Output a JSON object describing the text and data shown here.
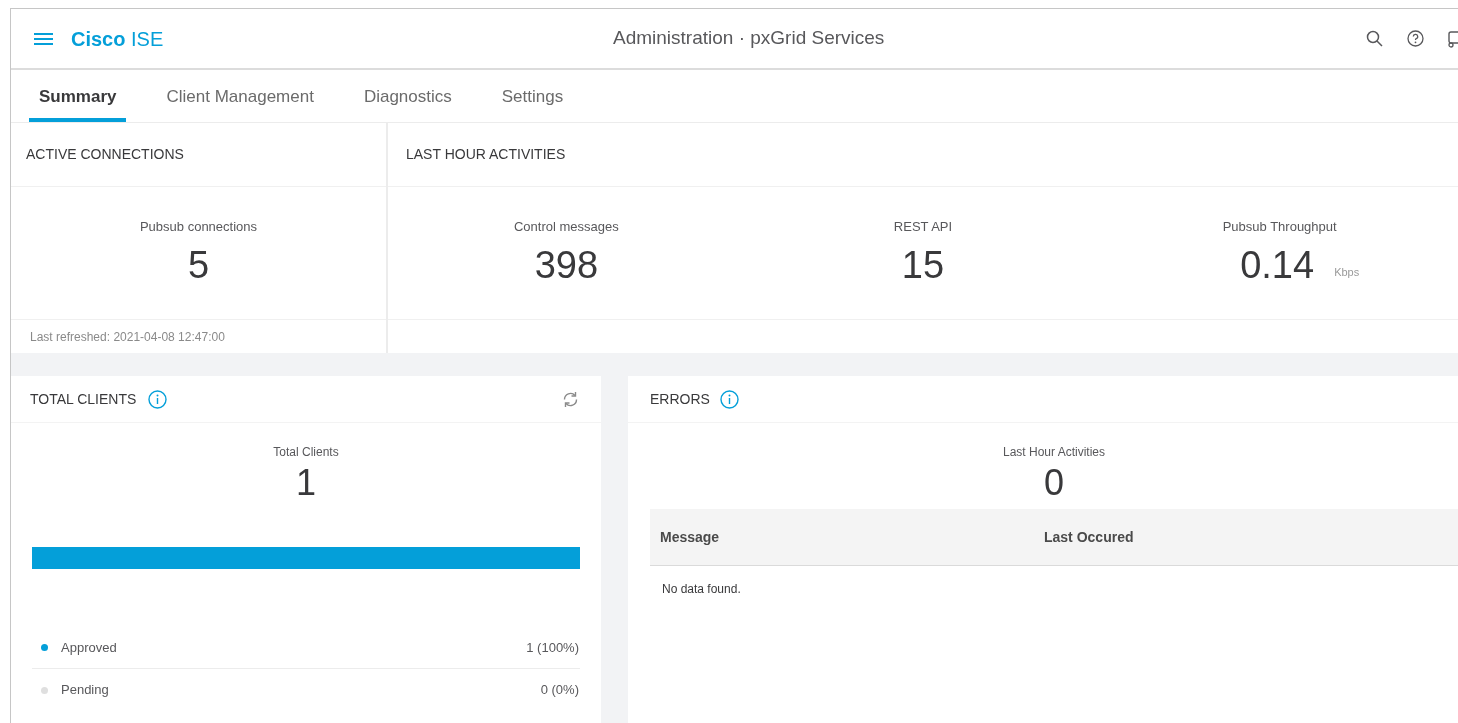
{
  "header": {
    "brand": "**Cisco** ISE",
    "title": "Administration · pxGrid Services"
  },
  "tabs": [
    {
      "label": "Summary",
      "selected": true
    },
    {
      "label": "Client Management",
      "selected": false
    },
    {
      "label": "Diagnostics",
      "selected": false
    },
    {
      "label": "Settings",
      "selected": false
    }
  ],
  "active_connections": {
    "title": "ACTIVE CONNECTIONS",
    "metric": {
      "label": "Pubsub connections",
      "value": "5"
    },
    "last_refreshed": "Last refreshed: 2021-04-08 12:47:00"
  },
  "last_hour_activities": {
    "title": "LAST HOUR ACTIVITIES",
    "metrics": [
      {
        "label": "Control messages",
        "value": "398"
      },
      {
        "label": "REST API",
        "value": "15"
      },
      {
        "label": "Pubsub Throughput",
        "value": "0.14",
        "unit": "Kbps"
      }
    ]
  },
  "total_clients": {
    "title": "TOTAL CLIENTS",
    "metric": {
      "label": "Total Clients",
      "value": "1"
    },
    "bar": {
      "level": 1.0
    },
    "legend": [
      {
        "label": "Approved",
        "value": "1 (100%)",
        "color": "#049fd9"
      },
      {
        "label": "Pending",
        "value": "0 (0%)",
        "color": "#dfdfdf"
      }
    ]
  },
  "errors": {
    "title": "ERRORS",
    "metric": {
      "label": "Last Hour Activities",
      "value": "0"
    },
    "table": {
      "columns": [
        "Message",
        "Last Occured"
      ],
      "empty_text": "No data found."
    }
  }
}
